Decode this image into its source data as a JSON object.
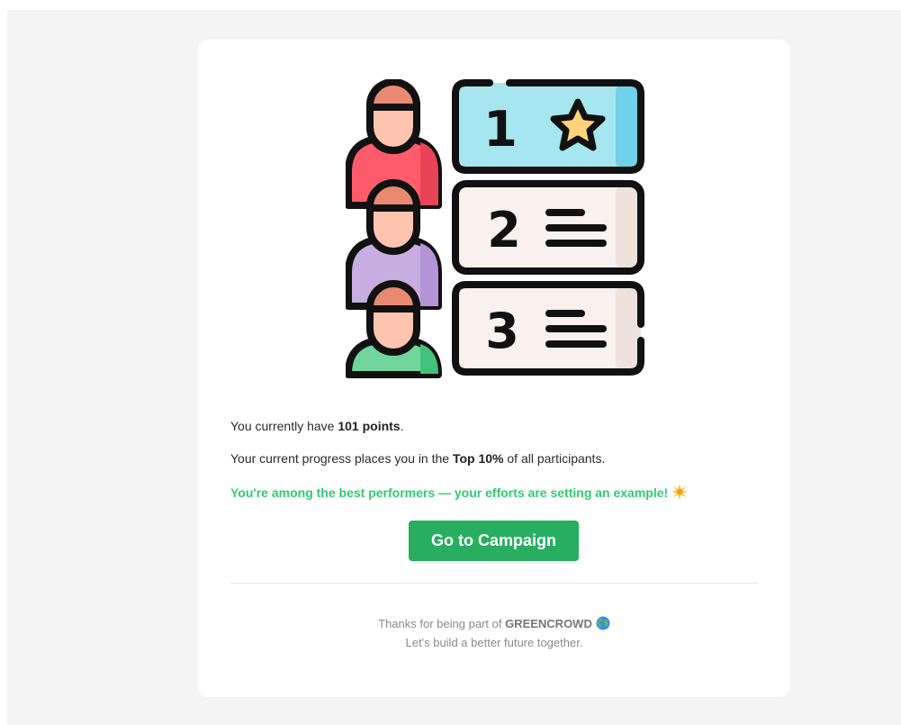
{
  "content": {
    "points_prefix": "You currently have ",
    "points_value": "101 points",
    "points_suffix": ".",
    "progress_prefix": "Your current progress places you in the ",
    "progress_value": "Top 10%",
    "progress_suffix": " of all participants.",
    "highlight": "You're among the best performers — your efforts are setting an example!",
    "highlight_icon": "sparkle-icon"
  },
  "button": {
    "label": "Go to Campaign"
  },
  "footer": {
    "thanks_prefix": "Thanks for being part of ",
    "brand": "GREENCROWD",
    "brand_icon": "globe-icon",
    "tagline": "Let's build a better future together."
  },
  "illustration": {
    "ranks": [
      "1",
      "2",
      "3"
    ],
    "icon": "leaderboard-illustration"
  },
  "colors": {
    "accent": "#27ae60",
    "highlight": "#2ecc71",
    "rank1_bg": "#a6e6ef",
    "star": "#ffd37a",
    "avatar_red": "#ff5b6b",
    "avatar_purple": "#c7aee0",
    "avatar_green": "#6fd59a"
  }
}
